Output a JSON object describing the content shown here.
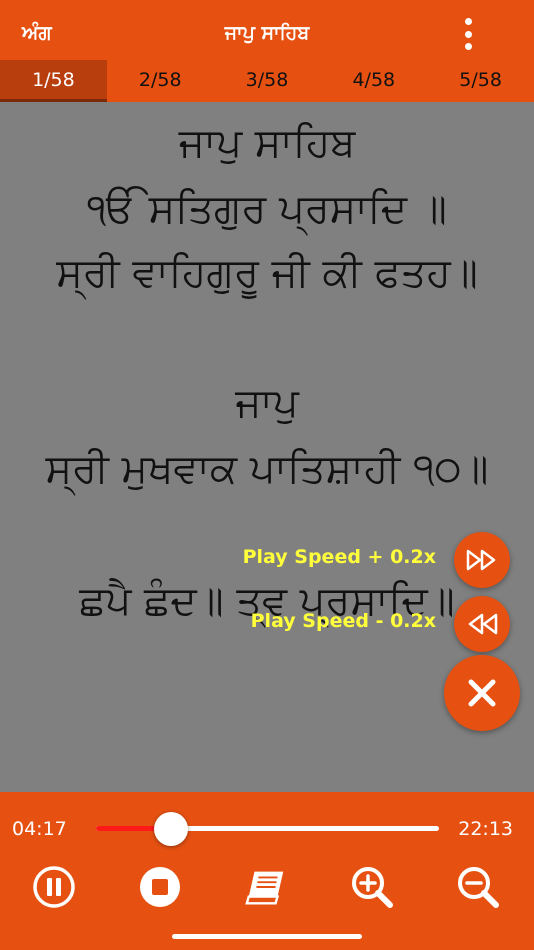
{
  "header": {
    "left_label": "ਅੰਗ",
    "title": "ਜਾਪੁ ਸਾਹਿਬ",
    "menu_icon": "more-vertical-icon"
  },
  "tabs": [
    {
      "label": "1/58",
      "active": true
    },
    {
      "label": "2/58"
    },
    {
      "label": "3/58"
    },
    {
      "label": "4/58"
    },
    {
      "label": "5/58"
    }
  ],
  "verses": [
    "ਜਾਪੁ ਸਾਹਿਬ",
    "ੴ ਸਤਿਗੁਰ ਪ੍ਰਸਾਦਿ ॥",
    "ਸ੍ਰੀ ਵਾਹਿਗੁਰੂ ਜੀ ਕੀ ਫਤਹ॥",
    "ਜਾਪੁ",
    "ਸ੍ਰੀ ਮੁਖਵਾਕ ਪਾਤਿਸ਼ਾਹੀ ੧੦॥",
    "ਛਪੈ ਛੰਦ॥ ਤ੍ਵ ਪ੍ਰਸਾਦਿ॥"
  ],
  "speed_controls": {
    "increase_label": "Play Speed + 0.2x",
    "decrease_label": "Play Speed - 0.2x"
  },
  "player": {
    "current_time": "04:17",
    "total_time": "22:13",
    "progress_fraction": 0.22
  },
  "colors": {
    "accent": "#e65112",
    "active_tab": "#b83f0d",
    "speed_label": "#ffff3b",
    "progress": "#ff1a1a",
    "content_bg": "#808080"
  }
}
